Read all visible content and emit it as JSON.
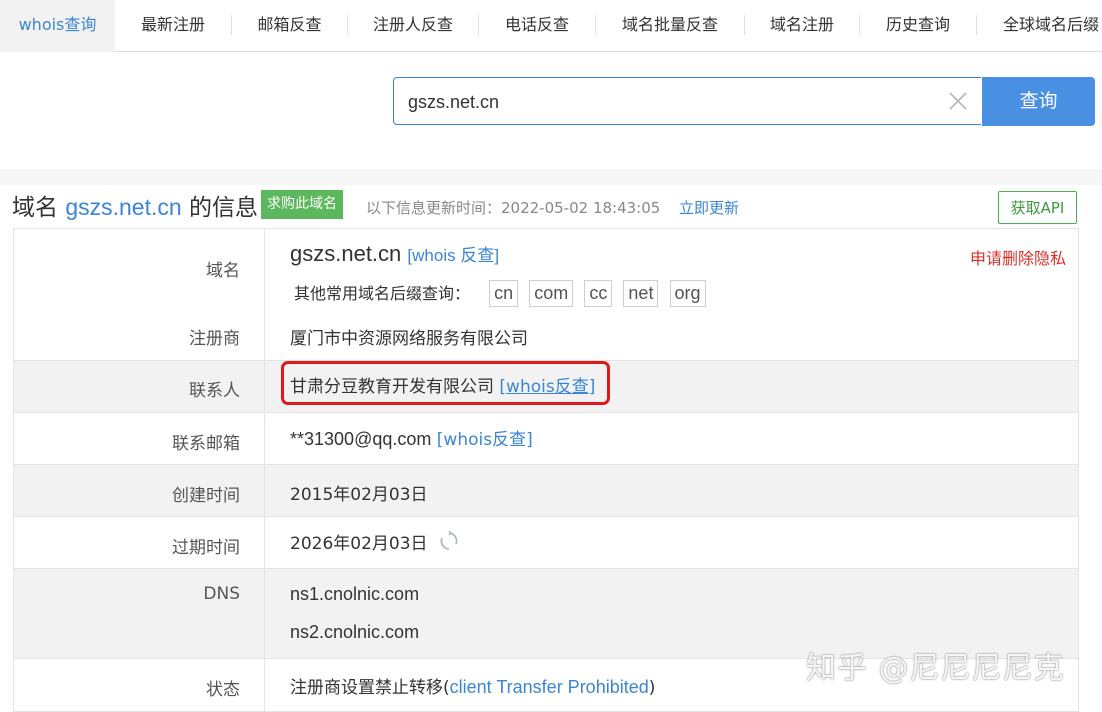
{
  "tabs": [
    {
      "label": "whois查询",
      "active": true
    },
    {
      "label": "最新注册"
    },
    {
      "label": "邮箱反查"
    },
    {
      "label": "注册人反查"
    },
    {
      "label": "电话反查"
    },
    {
      "label": "域名批量反查"
    },
    {
      "label": "域名注册"
    },
    {
      "label": "历史查询"
    },
    {
      "label": "全球域名后缀"
    }
  ],
  "search": {
    "value": "gszs.net.cn",
    "button_label": "查询",
    "clear_icon": "close-icon"
  },
  "header": {
    "title_prefix": "域名",
    "title_domain": "gszs.net.cn",
    "title_suffix": "的信息",
    "buy_label": "求购此域名",
    "updated_text": "以下信息更新时间：2022-05-02 18:43:05",
    "refresh_label": "立即更新",
    "api_label": "获取API"
  },
  "info": {
    "domain_label": "域名",
    "domain_value": "gszs.net.cn",
    "domain_whois_link": "[whois 反查]",
    "privacy_link": "申请删除隐私",
    "suffix_label": "其他常用域名后缀查询：",
    "suffixes": [
      "cn",
      "com",
      "cc",
      "net",
      "org"
    ],
    "registrar_label": "注册商",
    "registrar_value": "厦门市中资源网络服务有限公司",
    "contact_label": "联系人",
    "contact_value": "甘肃分豆教育开发有限公司",
    "contact_whois_link": "[whois反查]",
    "email_label": "联系邮箱",
    "email_value": "**31300@qq.com",
    "email_whois_link": "[whois反查]",
    "created_label": "创建时间",
    "created_value": "2015年02月03日",
    "expire_label": "过期时间",
    "expire_value": "2026年02月03日",
    "dns_label": "DNS",
    "dns_values": [
      "ns1.cnolnic.com",
      "ns2.cnolnic.com"
    ],
    "status_label": "状态",
    "status_prefix": "注册商设置禁止转移(",
    "status_link": "client Transfer Prohibited",
    "status_suffix": ")"
  },
  "watermark": "知乎 @尼尼尼尼克",
  "colors": {
    "accent": "#3a86d4",
    "button": "#4a90e2",
    "badge": "#5cb85c",
    "highlight": "#e0171b",
    "privacy": "#d9302a"
  }
}
